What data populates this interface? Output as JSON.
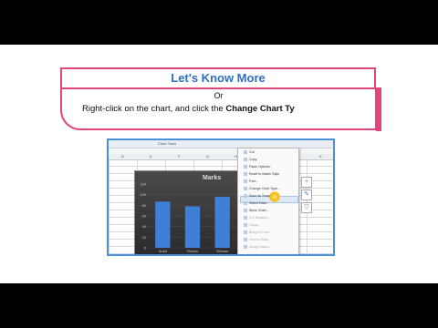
{
  "card": {
    "title": "Let's Know More",
    "or_text": "Or",
    "instruction_prefix": "Right-click on the chart, and click the ",
    "instruction_bold": "Change Chart Ty"
  },
  "screenshot": {
    "ribbon_label": "Chart Tools",
    "columns": [
      "D",
      "E",
      "F",
      "G",
      "H",
      "I",
      "J",
      "K"
    ],
    "menu_items": [
      {
        "label": "Cut",
        "dim": false
      },
      {
        "label": "Copy",
        "dim": false
      },
      {
        "label": "Paste Options:",
        "dim": false
      },
      {
        "label": "Reset to Match Style",
        "dim": false
      },
      {
        "label": "Font...",
        "dim": false
      },
      {
        "label": "Change Chart Type...",
        "dim": false
      },
      {
        "label": "Save as Template...",
        "dim": false
      },
      {
        "label": "Select Data...",
        "dim": false
      },
      {
        "label": "Move Chart...",
        "dim": false
      },
      {
        "label": "3-D Rotation...",
        "dim": true
      },
      {
        "label": "Group",
        "dim": true
      },
      {
        "label": "Bring to Front",
        "dim": true
      },
      {
        "label": "Send to Back",
        "dim": true
      },
      {
        "label": "Assign Macro...",
        "dim": true
      }
    ],
    "side_buttons": [
      "+",
      "✎",
      "▽"
    ]
  },
  "chart_data": {
    "type": "bar",
    "title": "Marks",
    "categories": [
      "Ankit",
      "Rohan",
      "Shivam"
    ],
    "values": [
      87,
      78,
      96
    ],
    "ylim": [
      0,
      120
    ],
    "yticks": [
      0,
      20,
      40,
      60,
      80,
      100,
      120
    ],
    "bar_color": "#3f7fd6"
  }
}
